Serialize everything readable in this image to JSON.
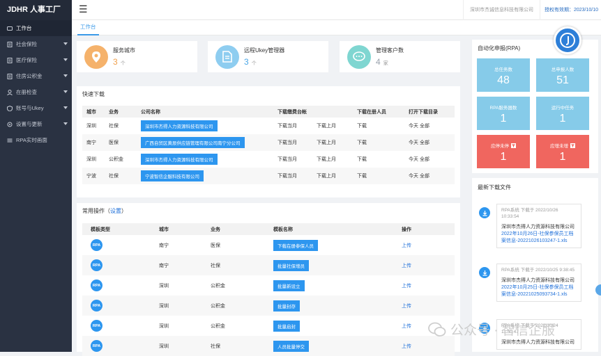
{
  "brand": {
    "logo": "JDHR 人事工厂"
  },
  "sidebar": {
    "items": [
      {
        "label": "工作台",
        "icon": "dashboard-icon",
        "has_caret": false,
        "active": true
      },
      {
        "label": "社会保险",
        "icon": "document-icon",
        "has_caret": true
      },
      {
        "label": "医疗保险",
        "icon": "document-icon",
        "has_caret": true
      },
      {
        "label": "住房公积金",
        "icon": "document-icon",
        "has_caret": true
      },
      {
        "label": "在册检查",
        "icon": "user-icon",
        "has_caret": true
      },
      {
        "label": "账号与Ukey",
        "icon": "shield-icon",
        "has_caret": true
      },
      {
        "label": "设置与更新",
        "icon": "settings-icon",
        "has_caret": true
      },
      {
        "label": "RPA实时画面",
        "icon": "list-icon",
        "has_caret": false
      }
    ]
  },
  "topbar": {
    "company": "深圳市杰诚信息科技有限公司",
    "license": "授权有效期：2023/10/10"
  },
  "tabs": [
    {
      "label": "工作台"
    }
  ],
  "stats": [
    {
      "label": "服务城市",
      "value": "3",
      "unit": "个",
      "color": "#f5b26b",
      "num_color": "#f0a04b",
      "icon": "location-icon"
    },
    {
      "label": "远程Ukey管理器",
      "value": "3",
      "unit": "个",
      "color": "#8ecdf0",
      "num_color": "#4aa6e6",
      "icon": "file-icon"
    },
    {
      "label": "管理客户数",
      "value": "4",
      "unit": "家",
      "color": "#7fd6d1",
      "num_color": "#9aa3ad",
      "icon": "chat-icon"
    }
  ],
  "quick_download": {
    "title": "快速下载",
    "headers": [
      "城市",
      "业务",
      "公司名称",
      "下载缴费台帐",
      "",
      "下载在册人员",
      "打开下载目录"
    ],
    "rows": [
      {
        "city": "深圳",
        "biz": "社保",
        "company": "深圳市杰得人力资源科技有限公司",
        "d1": "下载当月",
        "d2": "下载上月",
        "d3": "下载",
        "d4": "今天 全部"
      },
      {
        "city": "南宁",
        "biz": "医保",
        "company": "广西自贸区黄辰供应链管理有限公司南宁分公司",
        "d1": "下载当月",
        "d2": "下载上月",
        "d3": "下载",
        "d4": "今天 全部"
      },
      {
        "city": "深圳",
        "biz": "公积金",
        "company": "深圳市杰得人力资源科技有限公司",
        "d1": "下载当月",
        "d2": "下载上月",
        "d3": "下载",
        "d4": "今天 全部"
      },
      {
        "city": "宁波",
        "biz": "社保",
        "company": "宁波智信企服科技有限公司",
        "d1": "下载当月",
        "d2": "下载上月",
        "d3": "下载",
        "d4": "今天 全部"
      }
    ]
  },
  "common_ops": {
    "title": "常用操作",
    "paren_open": "（",
    "settings_link": "设置",
    "paren_close": "）",
    "headers": [
      "模板类型",
      "城市",
      "业务",
      "模板名称",
      "操作"
    ],
    "rows": [
      {
        "type": "RPA",
        "city": "南宁",
        "biz": "医保",
        "template": "下载在册参保人员",
        "action": "上传"
      },
      {
        "type": "RPA",
        "city": "南宁",
        "biz": "社保",
        "template": "批量社保增员",
        "action": "上传"
      },
      {
        "type": "RPA",
        "city": "深圳",
        "biz": "公积金",
        "template": "批量新设立",
        "action": "上传"
      },
      {
        "type": "RPA",
        "city": "深圳",
        "biz": "公积金",
        "template": "批量封存",
        "action": "上传"
      },
      {
        "type": "RPA",
        "city": "深圳",
        "biz": "公积金",
        "template": "批量启封",
        "action": "上传"
      },
      {
        "type": "RPA",
        "city": "深圳",
        "biz": "社保",
        "template": "人员批量停交",
        "action": "上传"
      }
    ]
  },
  "rpa_panel": {
    "title": "自动化申报(RPA)",
    "tiles": [
      {
        "label": "总任务数",
        "value": "48",
        "color": "#86cbe9"
      },
      {
        "label": "总申报人数",
        "value": "51",
        "color": "#86cbe9"
      },
      {
        "label": "RPA服务器数",
        "value": "1",
        "color": "#86cbe9"
      },
      {
        "label": "运行中任务",
        "value": "1",
        "color": "#86cbe9"
      },
      {
        "label": "应停未停",
        "value": "1",
        "color": "#f0665f"
      },
      {
        "label": "应增未增",
        "value": "1",
        "color": "#f0665f"
      }
    ]
  },
  "recent_files": {
    "title": "最新下载文件",
    "items": [
      {
        "head": "RPA系统 下载于 2022/10/26 10:33:54",
        "company": "深圳市杰得人力资源科技有限公司",
        "file": "2022年10月26日-社保参保员工档案信息-20221026103247-1.xls"
      },
      {
        "head": "RPA系统 下载于 2022/10/25 9:38:45",
        "company": "深圳市杰得人力资源科技有限公司",
        "file": "2022年10月25日-社保参保员工档案信息-20221025093734-1.xls"
      },
      {
        "head": "RPA系统 下载于 2022/10/24 11:50:47",
        "company": "深圳市杰得人力资源科技有限公司",
        "file": ""
      }
    ]
  },
  "watermark": {
    "text": "公众号 · 智信企服"
  }
}
